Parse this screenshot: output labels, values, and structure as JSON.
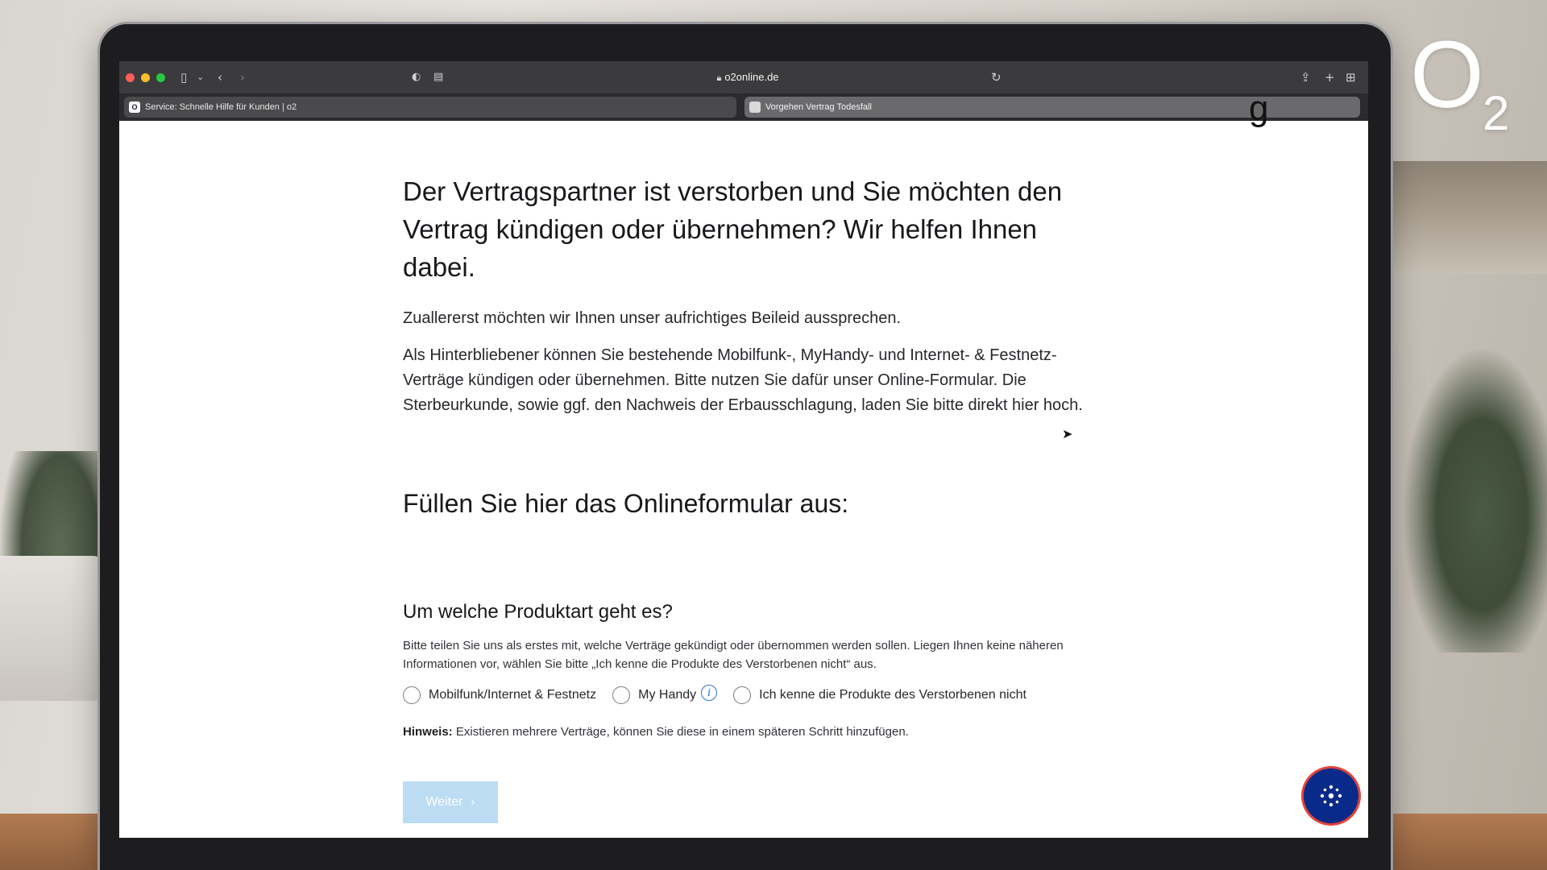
{
  "browser": {
    "url": "o2online.de",
    "tabs": [
      {
        "label": "Service: Schnelle Hilfe für Kunden | o2",
        "favicon": "O"
      },
      {
        "label": "Vorgehen Vertrag Todesfall",
        "favicon": ""
      }
    ]
  },
  "page": {
    "heading": "Der Vertragspartner ist verstorben und Sie möchten den Vertrag kündigen oder übernehmen? Wir helfen Ihnen dabei.",
    "paragraph1": "Zuallererst möchten wir Ihnen unser aufrichtiges Beileid aussprechen.",
    "paragraph2": "Als Hinterbliebener können Sie bestehende Mobilfunk-, MyHandy- und Internet- & Festnetz-Verträge kündigen oder übernehmen. Bitte nutzen Sie dafür unser Online-Formular. Die Sterbeurkunde, sowie ggf. den Nachweis der Erbausschlagung, laden Sie bitte direkt hier hoch.",
    "form_heading": "Füllen Sie hier das Onlineformular aus:",
    "question": "Um welche Produktart geht es?",
    "question_desc": "Bitte teilen Sie uns als erstes mit, welche Verträge gekündigt oder übernommen werden sollen. Liegen Ihnen keine näheren Informationen vor, wählen Sie bitte „Ich kenne die Produkte des Verstorbenen nicht“ aus.",
    "options": [
      "Mobilfunk/Internet & Festnetz",
      "My Handy",
      "Ich kenne die Produkte des Verstorbenen nicht"
    ],
    "hint_label": "Hinweis:",
    "hint_text": " Existieren mehrere Verträge, können Sie diese in einem späteren Schritt hinzufügen.",
    "next_button": "Weiter",
    "title_fragment": "g"
  },
  "brand": {
    "logo_o": "O",
    "logo_2": "2"
  },
  "colors": {
    "accent_blue": "#2b6fd6",
    "button_disabled": "#bcdcf3",
    "chat_button": "#0a2a8a"
  }
}
